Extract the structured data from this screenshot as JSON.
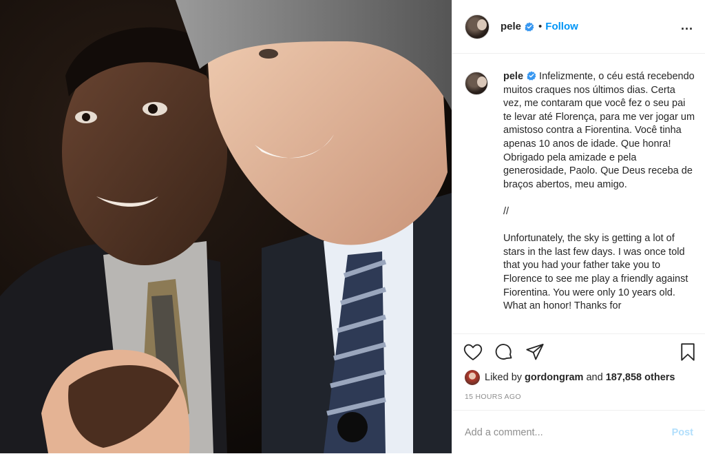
{
  "header": {
    "username": "pele",
    "dot": "•",
    "follow_label": "Follow",
    "more_label": "..."
  },
  "caption": {
    "username": "pele",
    "text": "Infelizmente, o céu está recebendo muitos craques nos últimos dias. Certa vez, me contaram que você fez o seu pai te levar até Florença, para me ver jogar um amistoso contra a Fiorentina. Você tinha apenas 10 anos de idade. Que honra! Obrigado pela amizade e pela generosidade, Paolo. Que Deus receba de braços abertos, meu amigo.\n\n//\n\nUnfortunately, the sky is getting a lot of stars in the last few days. I was once told that you had your father take you to Florence to see me play a friendly against Fiorentina. You were only 10 years old. What an honor! Thanks for"
  },
  "actions": {
    "icons": [
      "heart-icon",
      "comment-icon",
      "share-icon",
      "bookmark-icon"
    ],
    "liked_prefix": "Liked by",
    "liked_user": "gordongram",
    "liked_mid": "and",
    "liked_count": "187,858 others",
    "timestamp": "15 HOURS AGO"
  },
  "comment": {
    "placeholder": "Add a comment...",
    "post_label": "Post"
  },
  "colors": {
    "accent": "#0095f6",
    "post_disabled": "#b2dffc",
    "verified": "#3897f0",
    "muted": "#8e8e8e"
  }
}
